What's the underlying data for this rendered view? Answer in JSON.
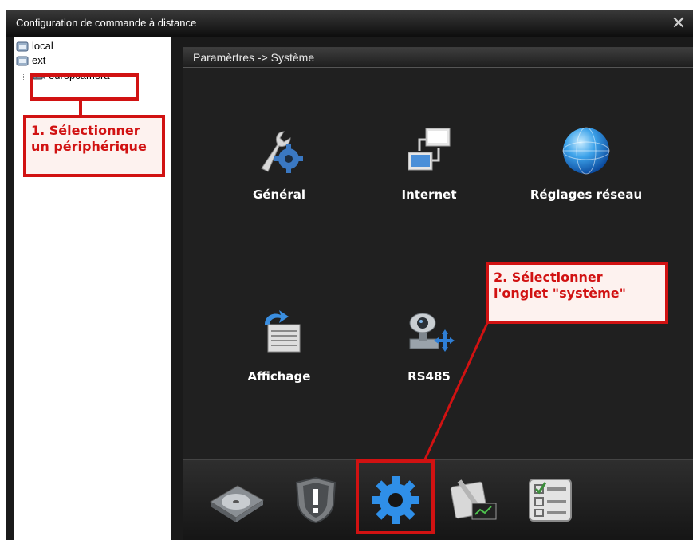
{
  "window": {
    "title": "Configuration de commande à distance",
    "close_glyph": "✕"
  },
  "tree": {
    "items": [
      {
        "label": "local",
        "icon": "network-node-icon"
      },
      {
        "label": "ext",
        "icon": "network-node-icon"
      },
      {
        "label": "europcamera",
        "icon": "camera-device-icon"
      }
    ]
  },
  "panel": {
    "breadcrumb": "Paramèrtres -> Système",
    "items": [
      {
        "label": "Général",
        "icon": "wrench-gear-icon"
      },
      {
        "label": "Internet",
        "icon": "network-computers-icon"
      },
      {
        "label": "Réglages réseau",
        "icon": "globe-icon"
      },
      {
        "label": "Affichage",
        "icon": "display-settings-icon"
      },
      {
        "label": "RS485",
        "icon": "ptz-camera-icon"
      }
    ]
  },
  "toolbar": {
    "buttons": [
      {
        "name": "storage",
        "icon": "hard-disk-icon"
      },
      {
        "name": "alarm",
        "icon": "shield-alert-icon"
      },
      {
        "name": "system",
        "icon": "gear-icon",
        "selected": true
      },
      {
        "name": "tools",
        "icon": "tools-icon"
      },
      {
        "name": "info",
        "icon": "checklist-icon"
      }
    ]
  },
  "annotations": {
    "step1": "1. Sélectionner un périphérique",
    "step2": "2. Sélectionner l'onglet \"système\""
  },
  "colors": {
    "highlight": "#d11212",
    "panel_bg": "#202020",
    "selected_icon": "#2f8fe8"
  }
}
